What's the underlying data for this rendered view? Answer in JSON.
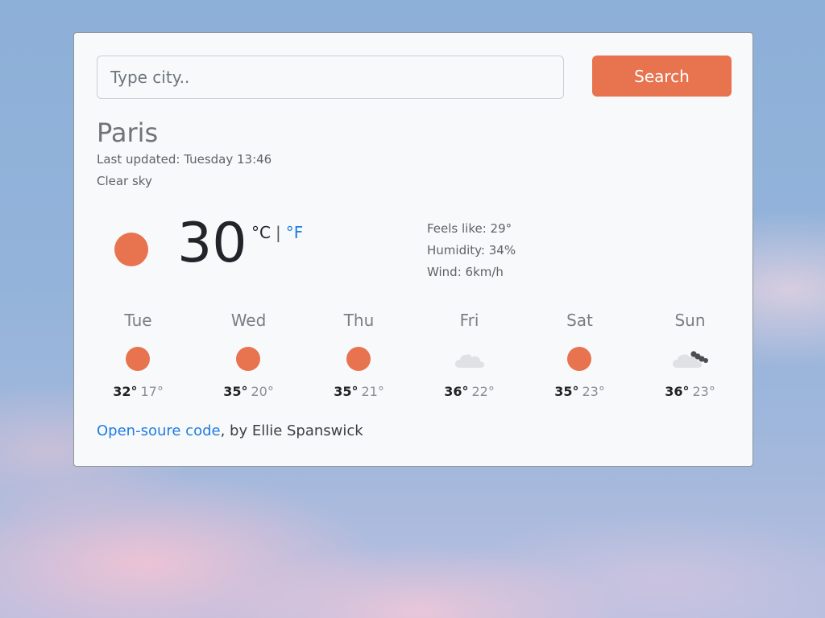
{
  "search": {
    "placeholder": "Type city..",
    "button_label": "Search"
  },
  "current": {
    "city": "Paris",
    "last_updated": "Last updated: Tuesday 13:46",
    "description": "Clear sky",
    "icon": "sun-icon",
    "temperature": "30",
    "unit_c": "°C",
    "unit_separator": "|",
    "unit_f": "°F",
    "feels_like": "Feels like: 29°",
    "humidity": "Humidity: 34%",
    "wind": "Wind: 6km/h"
  },
  "forecast": [
    {
      "day": "Tue",
      "icon": "sun-icon",
      "max": "32°",
      "min": "17°"
    },
    {
      "day": "Wed",
      "icon": "sun-icon",
      "max": "35°",
      "min": "20°"
    },
    {
      "day": "Thu",
      "icon": "sun-icon",
      "max": "35°",
      "min": "21°"
    },
    {
      "day": "Fri",
      "icon": "cloud-icon",
      "max": "36°",
      "min": "22°"
    },
    {
      "day": "Sat",
      "icon": "sun-icon",
      "max": "35°",
      "min": "23°"
    },
    {
      "day": "Sun",
      "icon": "cloud-storm-icon",
      "max": "36°",
      "min": "23°"
    }
  ],
  "footer": {
    "link_text": "Open-soure code",
    "suffix": ", by Ellie Spanswick"
  },
  "colors": {
    "accent": "#e8734f",
    "link": "#1f7de2",
    "card_bg": "#f8f9fb"
  }
}
